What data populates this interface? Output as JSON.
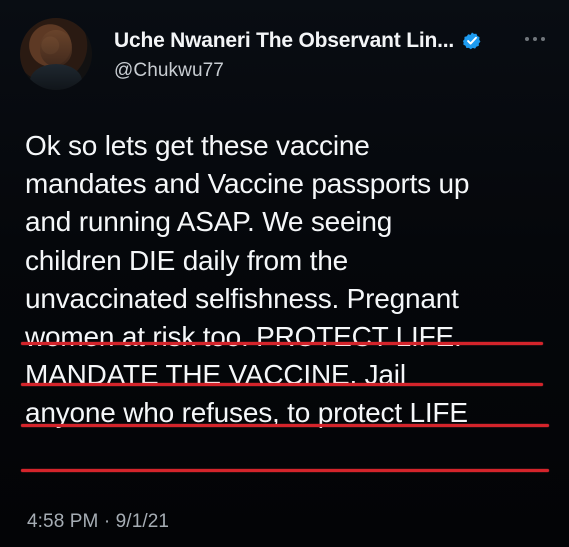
{
  "tweet": {
    "display_name": "Uche Nwaneri The Observant Lin...",
    "handle": "@Chukwu77",
    "timestamp": "4:58 PM · 9/1/21",
    "lines": [
      "Ok so lets get these vaccine",
      "mandates and Vaccine passports up",
      "and running ASAP. We seeing",
      "children DIE daily from the",
      "unvaccinated selfishness. Pregnant",
      "women at risk too. PROTECT LIFE.",
      "MANDATE THE VACCINE. Jail",
      "anyone who refuses, to protect LIFE"
    ],
    "icons": {
      "verified": "verified-badge-icon",
      "more": "more-options-icon"
    },
    "colors": {
      "background": "#05070b",
      "text": "#f5f7f9",
      "muted": "#a6adb4",
      "verified": "#1d9bf0",
      "underline": "#d4242b"
    }
  }
}
